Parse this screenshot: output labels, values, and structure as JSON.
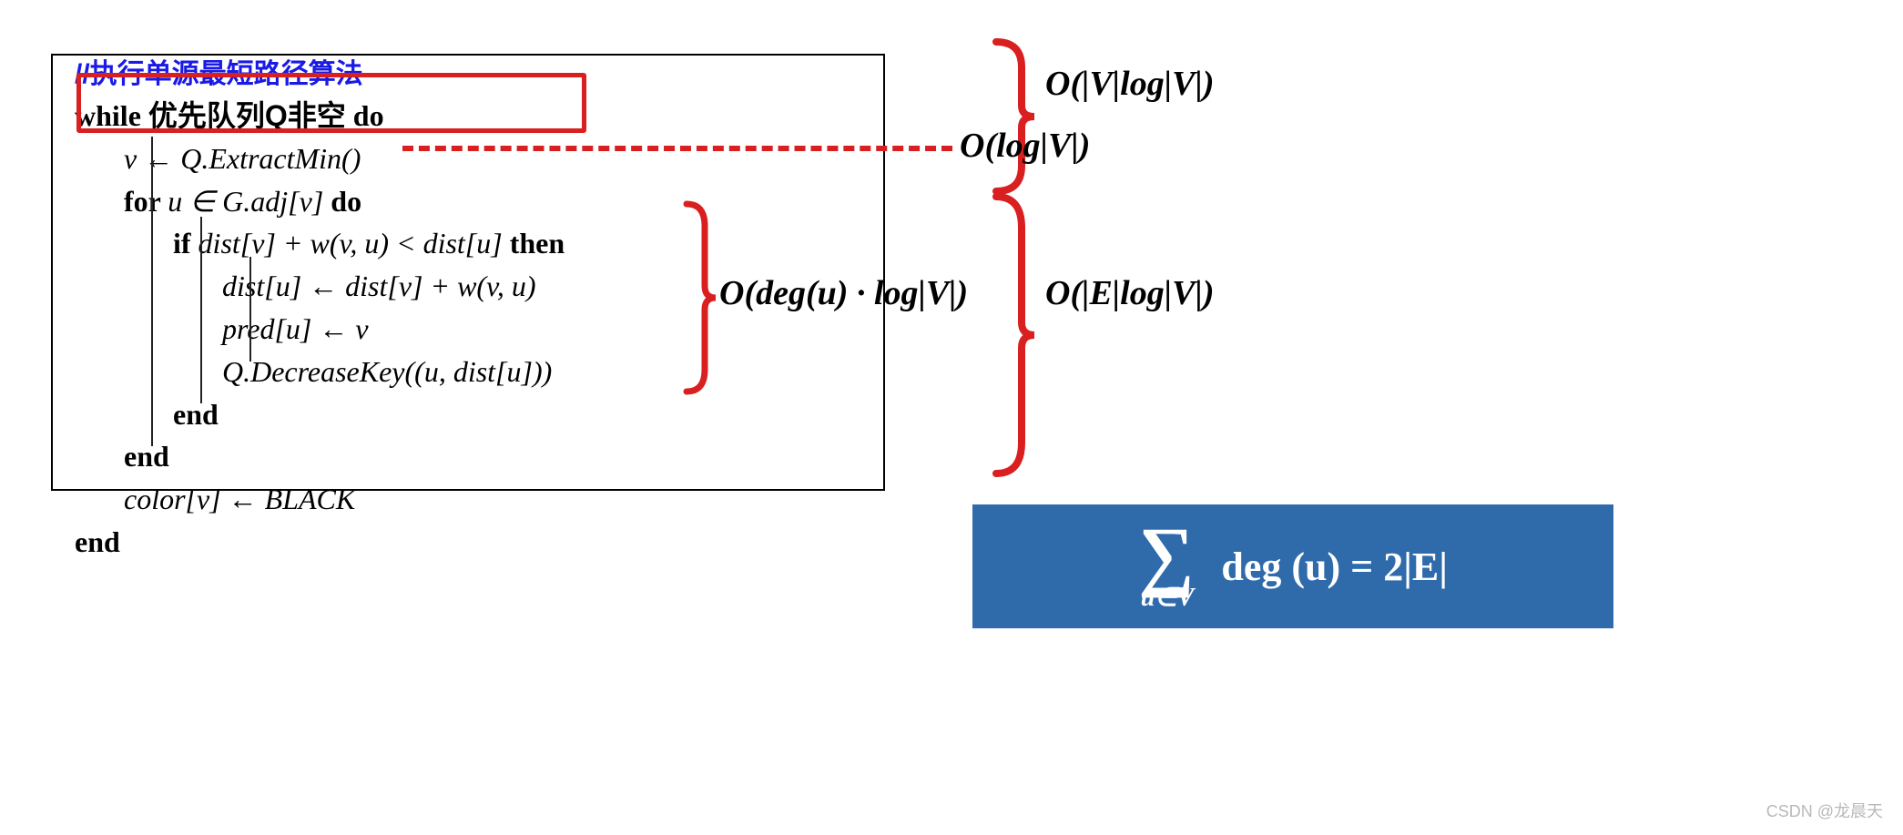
{
  "pseudocode": {
    "comment": "//执行单源最短路径算法",
    "while_prefix": "while ",
    "while_cn": "优先队列Q非空",
    "do": " do",
    "l1": "v ← Q.ExtractMin()",
    "l2_prefix": "for ",
    "l2_body": "u ∈ G.adj[v]",
    "l3_prefix": "if ",
    "l3_body": "dist[v] + w(v, u) < dist[u]",
    "l3_then": " then",
    "l4": "dist[u] ← dist[v] + w(v, u)",
    "l5": "pred[u] ← v",
    "l6": "Q.DecreaseKey((u, dist[u]))",
    "end": "end",
    "l8": "color[v] ← BLACK"
  },
  "annotations": {
    "extractmin": "O(log|V|)",
    "inner": "O(deg(u) · log|V|)",
    "top_brace": "O(|V|log|V|)",
    "bottom_brace": "O(|E|log|V|)"
  },
  "formula": {
    "sigma": "∑",
    "sub": "u∈V",
    "body": "deg (u) = 2|E|"
  },
  "watermark": "CSDN @龙晨天"
}
